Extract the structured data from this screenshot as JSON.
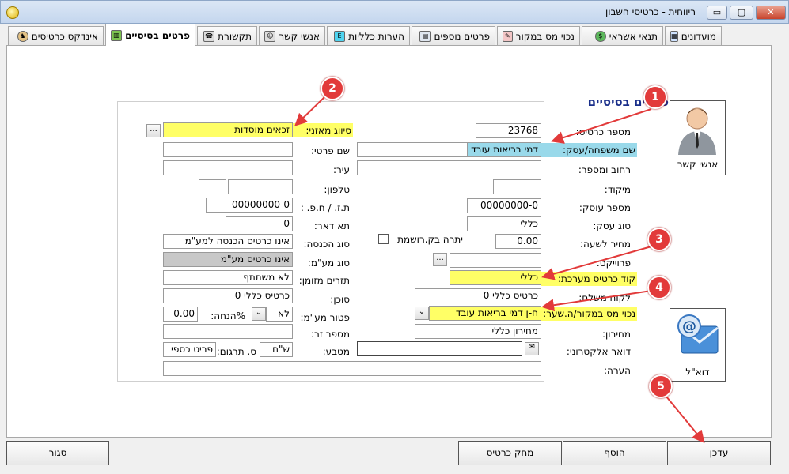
{
  "window": {
    "title": "ריווחית - כרטיסי חשבון",
    "minimize": "▭",
    "maximize": "▢",
    "close": "✕"
  },
  "tabs": [
    {
      "label": "מועדונים",
      "icon": "members-icon"
    },
    {
      "label": "תנאי אשראי",
      "icon": "money-bag-icon"
    },
    {
      "label": "נכוי מס במקור",
      "icon": "tax-icon"
    },
    {
      "label": "פרטים נוספים",
      "icon": "details-icon"
    },
    {
      "label": "הערות כלליות",
      "icon": "edit-icon"
    },
    {
      "label": "אנשי קשר",
      "icon": "contacts-icon"
    },
    {
      "label": "תקשורת",
      "icon": "phone-icon"
    },
    {
      "label": "פרטים בסיסיים",
      "icon": "book-icon",
      "active": true
    },
    {
      "label": "אינדקס כרטיסים",
      "icon": "dog-icon"
    }
  ],
  "form": {
    "heading": "פרטים בסיסיים",
    "card_number": {
      "label": "מספר כרטיס:",
      "value": "23768"
    },
    "family_name": {
      "label": "שם משפחה/עסק:",
      "value": "דמי בריאות עובד"
    },
    "street": {
      "label": "רחוב ומספר:",
      "value": ""
    },
    "zip": {
      "label": "מיקוד:",
      "value": ""
    },
    "business_number": {
      "label": "מספר עוסק:",
      "value": "00000000-0"
    },
    "business_type": {
      "label": "סוג עסק:",
      "value": "כללי"
    },
    "hourly_price": {
      "label": "מחיר לשעה:",
      "value": "0.00"
    },
    "registered_balance": {
      "label": "יתרה בק.רושמת"
    },
    "project": {
      "label": "פרוייקט:",
      "value": ""
    },
    "system_card_code": {
      "label": "קוד כרטיס מערכת:",
      "value": "כללי"
    },
    "paying_customer": {
      "label": "לקוח משלם:",
      "value": "כרטיס כללי 0"
    },
    "tax_withholding": {
      "label": "נכוי מס במקור/ה.שער:",
      "value": "ח-ן דמי בריאות עובד"
    },
    "price_list": {
      "label": "מחירון:",
      "value": "מחירון כללי"
    },
    "email": {
      "label": "דואר אלקטרוני:",
      "value": ""
    },
    "note": {
      "label": "הערה:",
      "value": ""
    },
    "balance_class": {
      "label": "סיווג מאזני:",
      "value": "זכאים מוסדות"
    },
    "private_name": {
      "label": "שם פרטי:",
      "value": ""
    },
    "city": {
      "label": "עיר:",
      "value": ""
    },
    "phone": {
      "label": "טלפון:",
      "value": ""
    },
    "id_number": {
      "label": "ת.ז. / ח.פ. :",
      "value": "00000000-0"
    },
    "po_box": {
      "label": "תא דאר:",
      "value": "0"
    },
    "income_type": {
      "label": "סוג הכנסה:",
      "value": "אינו כרטיס הכנסה למע\"מ"
    },
    "vat_type": {
      "label": "סוג מע\"מ:",
      "value": "אינו כרטיס מע\"מ"
    },
    "cash_flow": {
      "label": "תזרים מזומן:",
      "value": "לא משתתף"
    },
    "agent": {
      "label": "סוכן:",
      "value": "כרטיס כללי 0"
    },
    "vat_exempt": {
      "label": "פטור מע\"מ:",
      "value": "לא"
    },
    "discount": {
      "label": "%הנחה:",
      "value": "0.00"
    },
    "foreign_number": {
      "label": "מספר זר:",
      "value": ""
    },
    "currency": {
      "label": "מטבע:",
      "value": "ש\"ח"
    },
    "translation_type": {
      "label": "ס. תרגום:",
      "value": "פריט כספי"
    },
    "dots": "..."
  },
  "side": {
    "contacts": "אנשי קשר",
    "mail": "דוא\"ל"
  },
  "buttons": {
    "update": "עדכן",
    "add": "הוסף",
    "delete": "מחק כרטיס",
    "close": "סגור"
  },
  "callouts": [
    "1",
    "2",
    "3",
    "4",
    "5"
  ],
  "colors": {
    "highlight_yellow": "#ffff66",
    "highlight_blue": "#99d9ea",
    "callout_red": "#e23a3a",
    "heading_blue": "#1a2f8a"
  }
}
